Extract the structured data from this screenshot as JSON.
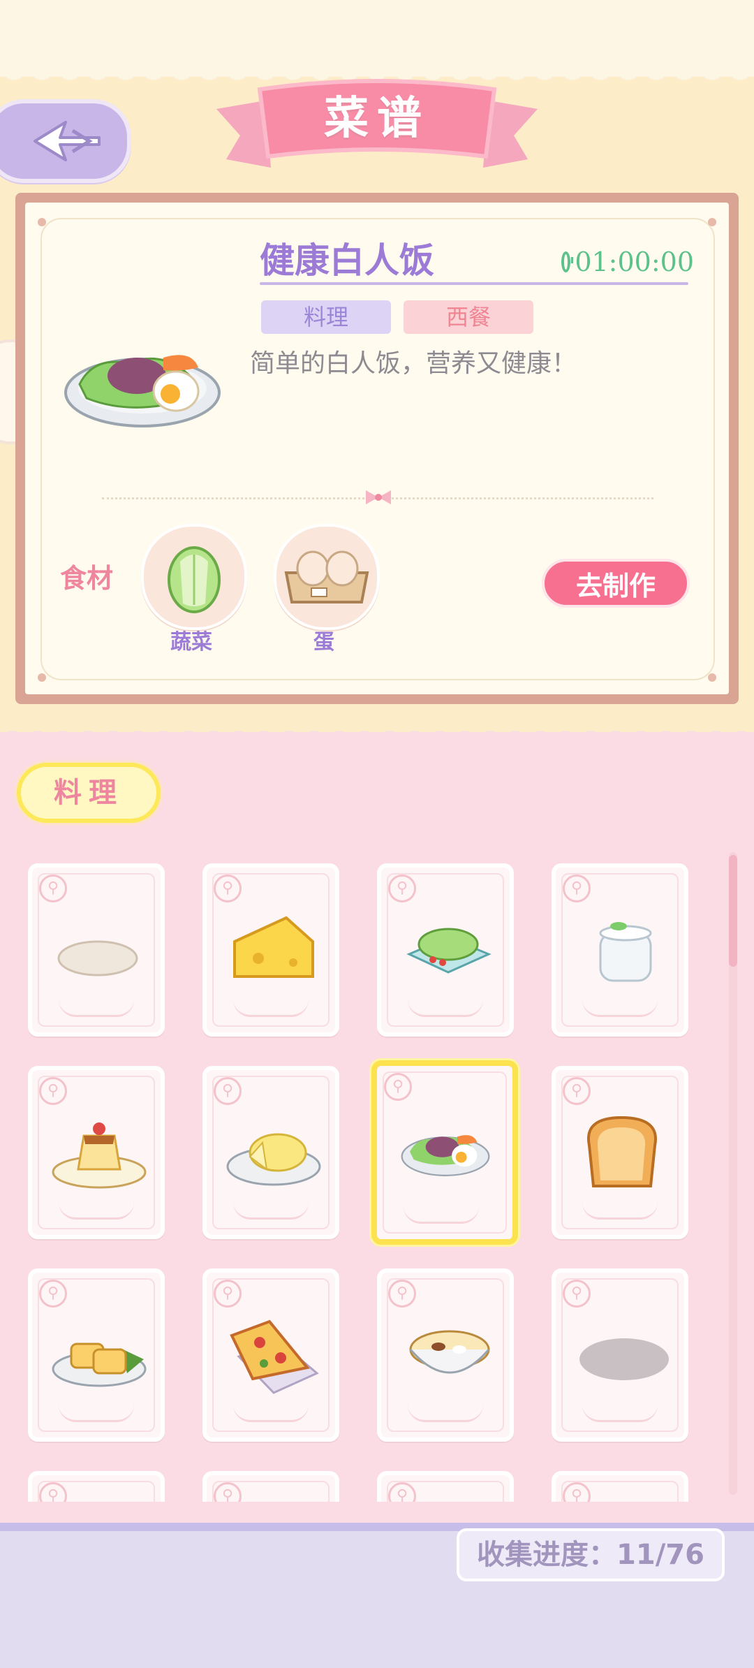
{
  "header": {
    "title": "菜谱"
  },
  "recipe": {
    "name": "健康白人饭",
    "timer": "01:00:00",
    "tags": [
      "料理",
      "西餐"
    ],
    "description": "简单的白人饭，营养又健康！",
    "ingredients_label": "食材",
    "ingredients": [
      {
        "name": "蔬菜",
        "icon": "cabbage-icon"
      },
      {
        "name": "蛋",
        "icon": "egg-carton-icon"
      }
    ],
    "make_button": "去制作"
  },
  "category_tab": "料理",
  "grid_items": [
    {
      "name": "flatbread",
      "selected": false
    },
    {
      "name": "cheese-wedge",
      "selected": false
    },
    {
      "name": "salad",
      "selected": false
    },
    {
      "name": "yogurt",
      "selected": false
    },
    {
      "name": "pudding",
      "selected": false
    },
    {
      "name": "cheese-wheel",
      "selected": false
    },
    {
      "name": "healthy-white-meal",
      "selected": true
    },
    {
      "name": "bread-loaf",
      "selected": false
    },
    {
      "name": "egg-rolls",
      "selected": false
    },
    {
      "name": "pizza-slice",
      "selected": false
    },
    {
      "name": "soup-bowl",
      "selected": false
    },
    {
      "name": "locked-dish",
      "selected": false
    },
    {
      "name": "hidden-1",
      "selected": false
    },
    {
      "name": "hidden-2",
      "selected": false
    },
    {
      "name": "hidden-3",
      "selected": false
    },
    {
      "name": "hidden-4",
      "selected": false
    }
  ],
  "progress": {
    "label": "收集进度：11/76"
  },
  "colors": {
    "accent_pink": "#f7708f",
    "purple": "#9b7bd6",
    "timer_green": "#5cc18a",
    "highlight_yellow": "#fde24f"
  }
}
